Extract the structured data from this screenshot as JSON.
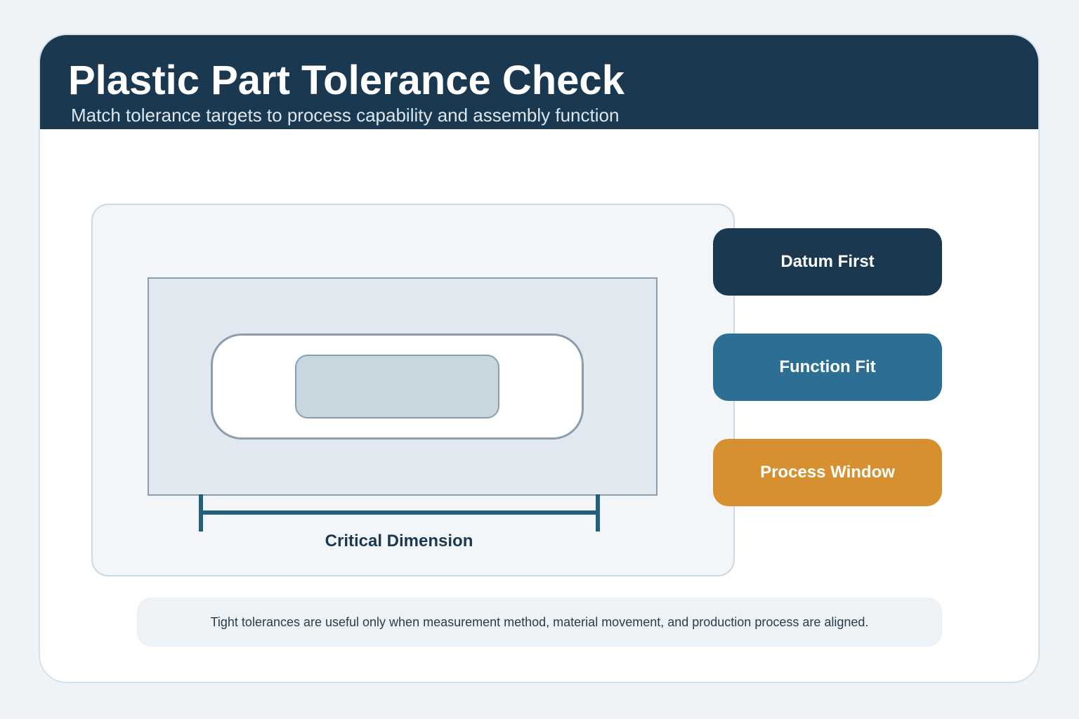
{
  "header": {
    "title": "Plastic Part Tolerance Check",
    "subtitle": "Match tolerance targets to process capability and assembly function"
  },
  "diagram": {
    "dimension_label": "Critical Dimension"
  },
  "tags": [
    {
      "label": "Datum First",
      "color": "#1a3850"
    },
    {
      "label": "Function Fit",
      "color": "#2d6f94"
    },
    {
      "label": "Process Window",
      "color": "#d79030"
    }
  ],
  "note": "Tight tolerances are useful only when measurement method, material movement, and production process are aligned.",
  "colors": {
    "primary": "#1a3850",
    "secondary": "#2d6f94",
    "accent": "#d79030",
    "background": "#eef3f7"
  }
}
